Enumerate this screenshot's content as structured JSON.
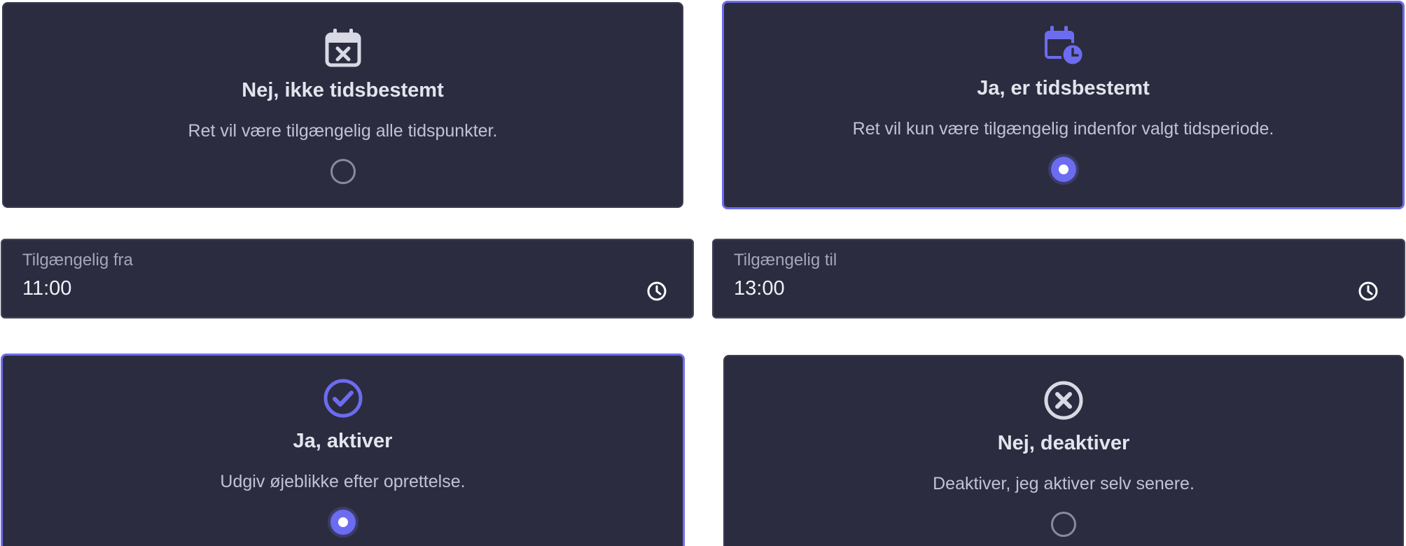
{
  "timed_options": [
    {
      "title": "Nej, ikke tidsbestemt",
      "description": "Ret vil være tilgængelig alle tidspunkter.",
      "icon": "calendar-x-icon",
      "selected": false
    },
    {
      "title": "Ja, er tidsbestemt",
      "description": "Ret vil kun være tilgængelig indenfor valgt tidsperiode.",
      "icon": "calendar-clock-icon",
      "selected": true
    }
  ],
  "time_fields": {
    "from": {
      "label": "Tilgængelig fra",
      "value": "11:00",
      "icon": "clock-icon"
    },
    "to": {
      "label": "Tilgængelig til",
      "value": "13:00",
      "icon": "clock-icon"
    }
  },
  "activation_options": [
    {
      "title": "Ja, aktiver",
      "description": "Udgiv øjeblikke efter oprettelse.",
      "icon": "check-circle-icon",
      "selected": true
    },
    {
      "title": "Nej, deaktiver",
      "description": "Deaktiver, jeg aktiver selv senere.",
      "icon": "x-circle-icon",
      "selected": false
    }
  ],
  "colors": {
    "card_bg": "#2c2c40",
    "accent": "#6c6cf0",
    "icon_neutral": "#d9d9e6"
  }
}
